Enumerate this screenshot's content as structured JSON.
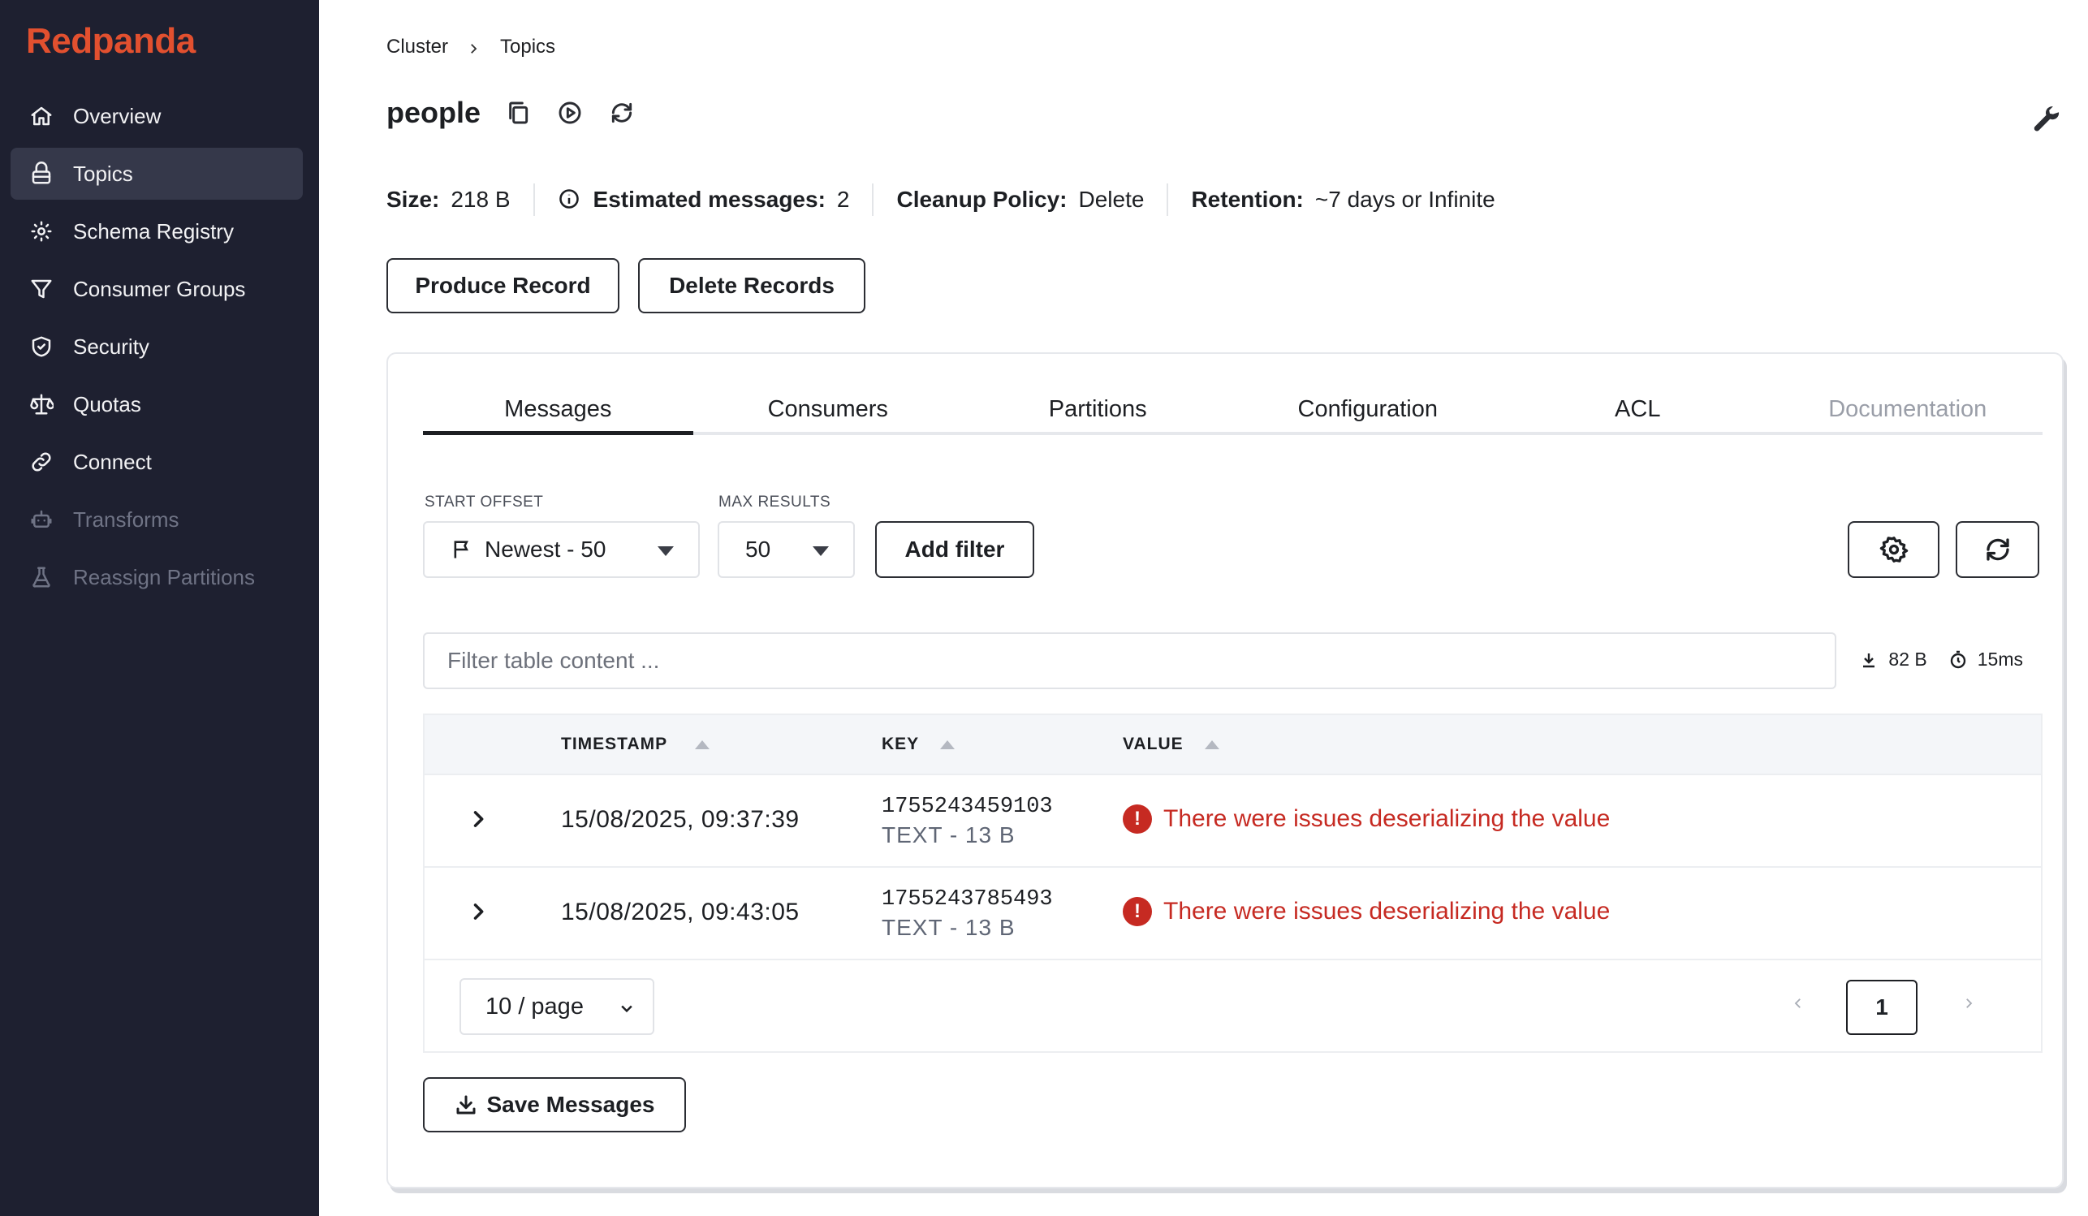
{
  "app": {
    "logo": "Redpanda"
  },
  "sidebar": {
    "items": [
      {
        "label": "Overview",
        "icon": "home-icon"
      },
      {
        "label": "Topics",
        "icon": "topics-icon"
      },
      {
        "label": "Schema Registry",
        "icon": "schema-icon"
      },
      {
        "label": "Consumer Groups",
        "icon": "funnel-icon"
      },
      {
        "label": "Security",
        "icon": "shield-icon"
      },
      {
        "label": "Quotas",
        "icon": "scale-icon"
      },
      {
        "label": "Connect",
        "icon": "link-icon"
      },
      {
        "label": "Transforms",
        "icon": "robot-icon"
      },
      {
        "label": "Reassign Partitions",
        "icon": "flask-icon"
      }
    ]
  },
  "breadcrumb": {
    "cluster": "Cluster",
    "topics": "Topics"
  },
  "topic": {
    "name": "people"
  },
  "stats": {
    "size_label": "Size:",
    "size_value": "218 B",
    "messages_label": "Estimated messages:",
    "messages_value": "2",
    "cleanup_label": "Cleanup Policy:",
    "cleanup_value": "Delete",
    "retention_label": "Retention:",
    "retention_value": "~7 days or Infinite"
  },
  "actions": {
    "produce": "Produce Record",
    "delete": "Delete Records"
  },
  "tabs": [
    "Messages",
    "Consumers",
    "Partitions",
    "Configuration",
    "ACL",
    "Documentation"
  ],
  "controls": {
    "start_offset_label": "START OFFSET",
    "start_offset_value": "Newest - 50",
    "max_results_label": "MAX RESULTS",
    "max_results_value": "50",
    "add_filter": "Add filter"
  },
  "filter": {
    "placeholder": "Filter table content ..."
  },
  "meta": {
    "bytes": "82 B",
    "time": "15ms"
  },
  "table": {
    "headers": {
      "timestamp": "TIMESTAMP",
      "key": "KEY",
      "value": "VALUE"
    },
    "rows": [
      {
        "timestamp": "15/08/2025, 09:37:39",
        "key": "1755243459103",
        "key_type": "TEXT - 13 B",
        "value": "There were issues deserializing the value"
      },
      {
        "timestamp": "15/08/2025, 09:43:05",
        "key": "1755243785493",
        "key_type": "TEXT - 13 B",
        "value": "There were issues deserializing the value"
      }
    ]
  },
  "pagination": {
    "page_size": "10 / page",
    "current_page": "1"
  },
  "save_messages": "Save Messages",
  "colors": {
    "brand": "#e2502f",
    "sidebar_bg": "#1e2030",
    "error": "#c62a22"
  }
}
